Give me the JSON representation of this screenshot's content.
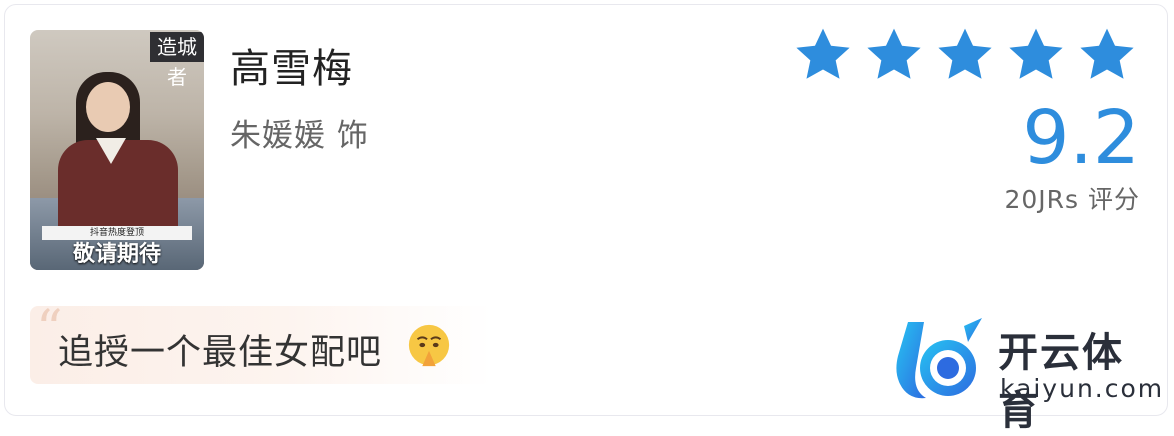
{
  "character": {
    "name": "高雪梅",
    "actor_line": "朱媛媛 饰",
    "poster": {
      "banner_text": "造城者",
      "strip_text": "抖音热度登顶",
      "caption": "敬请期待"
    }
  },
  "rating": {
    "score": "9.2",
    "count_label": "20JRs 评分",
    "stars_filled": 5,
    "star_color": "#2e8ddd"
  },
  "comment": {
    "text": "追授一个最佳女配吧",
    "emoji": "pleading-hands-emoji"
  },
  "watermark": {
    "brand": "开云体育",
    "domain": "kaiyun.com"
  }
}
